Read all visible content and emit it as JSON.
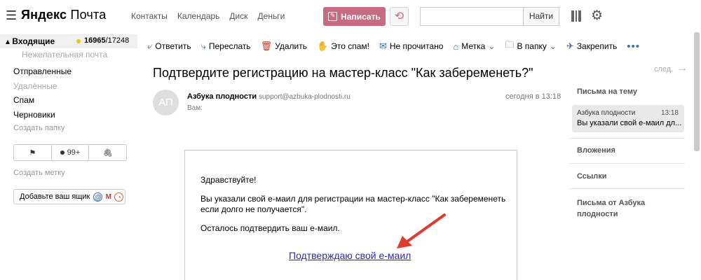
{
  "header": {
    "logo_brand": "Яндекс",
    "logo_product": "Почта",
    "nav": [
      "Контакты",
      "Календарь",
      "Диск",
      "Деньги"
    ],
    "compose_label": "Написать",
    "search_placeholder": "",
    "search_button": "Найти"
  },
  "sidebar": {
    "inbox_label": "Входящие",
    "inbox_unread": "16965",
    "inbox_total": "/17248",
    "spam_sub": "Нежелательная почта",
    "folders": [
      "Отправленные",
      "Удалённые",
      "Спам",
      "Черновики"
    ],
    "create_folder": "Создать папку",
    "badge_count": "99+",
    "create_label": "Создать метку",
    "add_mailbox": "Добавьте ваш ящик"
  },
  "toolbar": {
    "reply": "Ответить",
    "forward": "Переслать",
    "delete": "Удалить",
    "spam": "Это спам!",
    "unread": "Не прочитано",
    "label": "Метка",
    "to_folder": "В папку",
    "pin": "Закрепить"
  },
  "message": {
    "subject": "Подтвердите регистрацию на мастер-класс \"Как забеременеть?\"",
    "next": "след.",
    "avatar_initials": "АП",
    "sender_name": "Азбука плодности",
    "sender_email": "support@azbuka-plodnosti.ru",
    "to": "Вам:",
    "time": "сегодня в 13:18",
    "greeting": "Здравствуйте!",
    "body": "Вы указали свой е-маил для регистрации на мастер-класс \"Как забеременеть если долго не получается\".",
    "confirm_prompt": "Осталось подтвердить ваш е-маил.",
    "confirm_link": "Подтверждаю свой е-маил"
  },
  "right_panel": {
    "thread_title": "Письма на тему",
    "card_from": "Азбука плодности",
    "card_time": "13:18",
    "card_text": "Вы указали свой е-маил дл...",
    "attachments": "Вложения",
    "links": "Ссылки",
    "from_sender": "Письма от Азбука плодности"
  },
  "colors": {
    "compose": "#c76b81",
    "toolbar_icon": "#3d6fa8",
    "link": "#2c2ca8",
    "arrow": "#e03a2e"
  }
}
